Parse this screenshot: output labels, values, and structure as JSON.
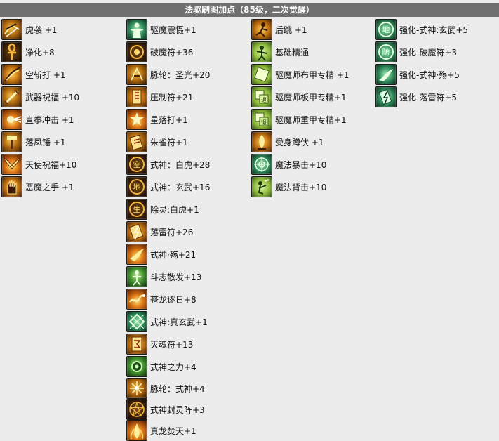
{
  "header": {
    "title": "法驱刷图加点（85级，二次觉醒）"
  },
  "columns": [
    [
      {
        "label": "虎袭 +1",
        "icon": "tiger-claw-icon"
      },
      {
        "label": "净化+8",
        "icon": "ankh-icon"
      },
      {
        "label": "空斩打 +1",
        "icon": "slash-icon"
      },
      {
        "label": "武器祝福 +10",
        "icon": "weapon-blessing-icon"
      },
      {
        "label": "直拳冲击 +1",
        "icon": "fist-impact-icon"
      },
      {
        "label": "落凤锤 +1",
        "icon": "hammer-icon"
      },
      {
        "label": "天使祝福+10",
        "icon": "angel-wings-icon"
      },
      {
        "label": "恶魔之手 +1",
        "icon": "demon-hand-icon"
      }
    ],
    [
      {
        "label": "驱魔震慑+1",
        "icon": "exorcist-figure-icon"
      },
      {
        "label": "破魔符+36",
        "icon": "burst-talisman-icon"
      },
      {
        "label": "脉轮：圣光+20",
        "icon": "chakra-light-icon"
      },
      {
        "label": "压制符+21",
        "icon": "suppress-talisman-icon"
      },
      {
        "label": "星落打+1",
        "icon": "star-fall-icon"
      },
      {
        "label": "朱雀符+1",
        "icon": "phoenix-talisman-icon"
      },
      {
        "label": "式神：白虎+28",
        "icon": "shikigami-white-tiger-icon"
      },
      {
        "label": "式神：玄武+16",
        "icon": "shikigami-black-tortoise-icon"
      },
      {
        "label": "除灵:白虎+1",
        "icon": "exorcise-tiger-icon"
      },
      {
        "label": "落雷符+26",
        "icon": "thunder-talisman-icon"
      },
      {
        "label": "式神·殇+21",
        "icon": "shikigami-shang-icon"
      },
      {
        "label": "斗志散发+13",
        "icon": "fighting-spirit-icon"
      },
      {
        "label": "苍龙逐日+8",
        "icon": "azure-dragon-icon"
      },
      {
        "label": "式神:真玄武+1",
        "icon": "true-tortoise-icon"
      },
      {
        "label": "灭魂符+13",
        "icon": "soul-destroy-talisman-icon"
      },
      {
        "label": "式神之力+4",
        "icon": "shikigami-power-icon"
      },
      {
        "label": "脉轮：式神+4",
        "icon": "chakra-shikigami-icon"
      },
      {
        "label": "式神封灵阵+3",
        "icon": "seal-array-icon"
      },
      {
        "label": "真龙焚天+1",
        "icon": "true-dragon-icon"
      }
    ],
    [
      {
        "label": "后跳 +1",
        "icon": "back-jump-icon"
      },
      {
        "label": "基础精通",
        "icon": "basic-mastery-icon"
      },
      {
        "label": "驱魔师布甲专精 +1",
        "icon": "cloth-armor-icon"
      },
      {
        "label": "驱魔师板甲专精+1",
        "icon": "plate-armor-icon"
      },
      {
        "label": "驱魔师重甲专精+1",
        "icon": "heavy-armor-icon"
      },
      {
        "label": "受身蹲伏 +1",
        "icon": "crouch-icon"
      },
      {
        "label": "魔法暴击+10",
        "icon": "magic-crit-icon"
      },
      {
        "label": "魔法背击+10",
        "icon": "magic-backstab-icon"
      }
    ],
    [
      {
        "label": "强化-式神:玄武+5",
        "icon": "enhance-tortoise-icon"
      },
      {
        "label": "强化-破魔符+3",
        "icon": "enhance-burst-icon"
      },
      {
        "label": "强化-式神·殇+5",
        "icon": "enhance-shang-icon"
      },
      {
        "label": "强化-落雷符+5",
        "icon": "enhance-thunder-icon"
      }
    ]
  ]
}
